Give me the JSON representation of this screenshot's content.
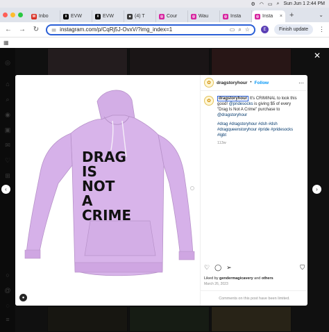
{
  "menubar": {
    "date_time": "Sun Jun 1  2:44 PM"
  },
  "tabs": [
    {
      "label": "Inbo",
      "fav": "M",
      "fav_color": "#d93025"
    },
    {
      "label": "EVW",
      "fav": "X",
      "fav_color": "#000000"
    },
    {
      "label": "EVW",
      "fav": "X",
      "fav_color": "#000000"
    },
    {
      "label": "(4) T",
      "fav": "■",
      "fav_color": "#3b3b3b"
    },
    {
      "label": "Cour",
      "fav": "◎",
      "fav_color": "#d6249f"
    },
    {
      "label": "Wau",
      "fav": "◎",
      "fav_color": "#d6249f"
    },
    {
      "label": "Insta",
      "fav": "◎",
      "fav_color": "#d6249f"
    },
    {
      "label": "Insta",
      "fav": "◎",
      "fav_color": "#d6249f",
      "active": true
    }
  ],
  "toolbar": {
    "url": "instagram.com/p/CqRj5J-OvxV/?img_index=1",
    "profile_initial": "E",
    "finish_update_label": "Finish update"
  },
  "post": {
    "username": "dragstoryhour",
    "follow_label": "Follow",
    "caption_user": "dragstoryhour",
    "caption_part1": " It's CRIMINAL to look this good! ",
    "mention1": "@pridesocks",
    "caption_part2": " is giving $5 of every \"Drag Is Not A Crime\" purchase to ",
    "mention2": "@dragstoryhour",
    "hashtags": "#drag #dragstoryhour #dsh #dsh #dragqueenstoryhour #pride #pridesocks #lgbt",
    "time_ago": "113w",
    "liked_by_prefix": "Liked by ",
    "liked_by_user": "gendermagicavery",
    "liked_by_and": " and ",
    "liked_by_others": "others",
    "date": "March 26, 2023",
    "comments_limited": "Comments on this post have been limited.",
    "hoodie_text": [
      "DRAG",
      "IS",
      "NOT",
      "A",
      "CRIME"
    ]
  },
  "colors": {
    "hoodie": "#d8b4ea",
    "hoodie_shadow": "#c6a0da",
    "accent_blue": "#0095f6",
    "url_focus": "#2a5fd6"
  }
}
